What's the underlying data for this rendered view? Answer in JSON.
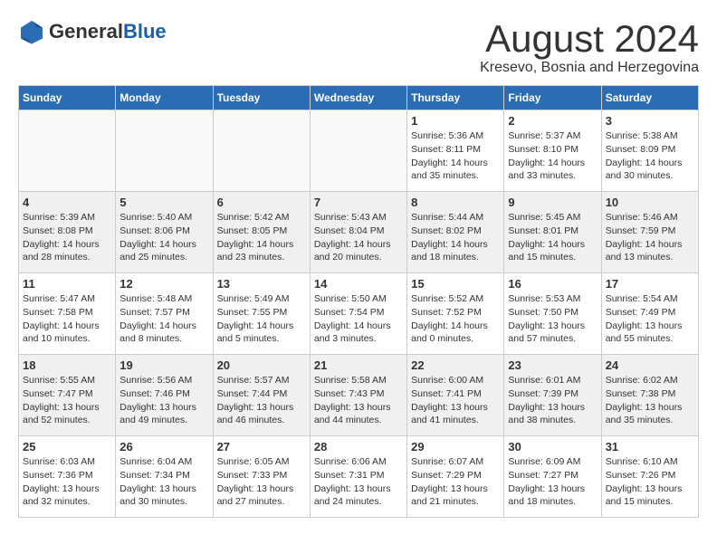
{
  "header": {
    "logo_general": "General",
    "logo_blue": "Blue",
    "month": "August 2024",
    "location": "Kresevo, Bosnia and Herzegovina"
  },
  "weekdays": [
    "Sunday",
    "Monday",
    "Tuesday",
    "Wednesday",
    "Thursday",
    "Friday",
    "Saturday"
  ],
  "weeks": [
    [
      {
        "day": "",
        "info": ""
      },
      {
        "day": "",
        "info": ""
      },
      {
        "day": "",
        "info": ""
      },
      {
        "day": "",
        "info": ""
      },
      {
        "day": "1",
        "info": "Sunrise: 5:36 AM\nSunset: 8:11 PM\nDaylight: 14 hours\nand 35 minutes."
      },
      {
        "day": "2",
        "info": "Sunrise: 5:37 AM\nSunset: 8:10 PM\nDaylight: 14 hours\nand 33 minutes."
      },
      {
        "day": "3",
        "info": "Sunrise: 5:38 AM\nSunset: 8:09 PM\nDaylight: 14 hours\nand 30 minutes."
      }
    ],
    [
      {
        "day": "4",
        "info": "Sunrise: 5:39 AM\nSunset: 8:08 PM\nDaylight: 14 hours\nand 28 minutes."
      },
      {
        "day": "5",
        "info": "Sunrise: 5:40 AM\nSunset: 8:06 PM\nDaylight: 14 hours\nand 25 minutes."
      },
      {
        "day": "6",
        "info": "Sunrise: 5:42 AM\nSunset: 8:05 PM\nDaylight: 14 hours\nand 23 minutes."
      },
      {
        "day": "7",
        "info": "Sunrise: 5:43 AM\nSunset: 8:04 PM\nDaylight: 14 hours\nand 20 minutes."
      },
      {
        "day": "8",
        "info": "Sunrise: 5:44 AM\nSunset: 8:02 PM\nDaylight: 14 hours\nand 18 minutes."
      },
      {
        "day": "9",
        "info": "Sunrise: 5:45 AM\nSunset: 8:01 PM\nDaylight: 14 hours\nand 15 minutes."
      },
      {
        "day": "10",
        "info": "Sunrise: 5:46 AM\nSunset: 7:59 PM\nDaylight: 14 hours\nand 13 minutes."
      }
    ],
    [
      {
        "day": "11",
        "info": "Sunrise: 5:47 AM\nSunset: 7:58 PM\nDaylight: 14 hours\nand 10 minutes."
      },
      {
        "day": "12",
        "info": "Sunrise: 5:48 AM\nSunset: 7:57 PM\nDaylight: 14 hours\nand 8 minutes."
      },
      {
        "day": "13",
        "info": "Sunrise: 5:49 AM\nSunset: 7:55 PM\nDaylight: 14 hours\nand 5 minutes."
      },
      {
        "day": "14",
        "info": "Sunrise: 5:50 AM\nSunset: 7:54 PM\nDaylight: 14 hours\nand 3 minutes."
      },
      {
        "day": "15",
        "info": "Sunrise: 5:52 AM\nSunset: 7:52 PM\nDaylight: 14 hours\nand 0 minutes."
      },
      {
        "day": "16",
        "info": "Sunrise: 5:53 AM\nSunset: 7:50 PM\nDaylight: 13 hours\nand 57 minutes."
      },
      {
        "day": "17",
        "info": "Sunrise: 5:54 AM\nSunset: 7:49 PM\nDaylight: 13 hours\nand 55 minutes."
      }
    ],
    [
      {
        "day": "18",
        "info": "Sunrise: 5:55 AM\nSunset: 7:47 PM\nDaylight: 13 hours\nand 52 minutes."
      },
      {
        "day": "19",
        "info": "Sunrise: 5:56 AM\nSunset: 7:46 PM\nDaylight: 13 hours\nand 49 minutes."
      },
      {
        "day": "20",
        "info": "Sunrise: 5:57 AM\nSunset: 7:44 PM\nDaylight: 13 hours\nand 46 minutes."
      },
      {
        "day": "21",
        "info": "Sunrise: 5:58 AM\nSunset: 7:43 PM\nDaylight: 13 hours\nand 44 minutes."
      },
      {
        "day": "22",
        "info": "Sunrise: 6:00 AM\nSunset: 7:41 PM\nDaylight: 13 hours\nand 41 minutes."
      },
      {
        "day": "23",
        "info": "Sunrise: 6:01 AM\nSunset: 7:39 PM\nDaylight: 13 hours\nand 38 minutes."
      },
      {
        "day": "24",
        "info": "Sunrise: 6:02 AM\nSunset: 7:38 PM\nDaylight: 13 hours\nand 35 minutes."
      }
    ],
    [
      {
        "day": "25",
        "info": "Sunrise: 6:03 AM\nSunset: 7:36 PM\nDaylight: 13 hours\nand 32 minutes."
      },
      {
        "day": "26",
        "info": "Sunrise: 6:04 AM\nSunset: 7:34 PM\nDaylight: 13 hours\nand 30 minutes."
      },
      {
        "day": "27",
        "info": "Sunrise: 6:05 AM\nSunset: 7:33 PM\nDaylight: 13 hours\nand 27 minutes."
      },
      {
        "day": "28",
        "info": "Sunrise: 6:06 AM\nSunset: 7:31 PM\nDaylight: 13 hours\nand 24 minutes."
      },
      {
        "day": "29",
        "info": "Sunrise: 6:07 AM\nSunset: 7:29 PM\nDaylight: 13 hours\nand 21 minutes."
      },
      {
        "day": "30",
        "info": "Sunrise: 6:09 AM\nSunset: 7:27 PM\nDaylight: 13 hours\nand 18 minutes."
      },
      {
        "day": "31",
        "info": "Sunrise: 6:10 AM\nSunset: 7:26 PM\nDaylight: 13 hours\nand 15 minutes."
      }
    ]
  ]
}
